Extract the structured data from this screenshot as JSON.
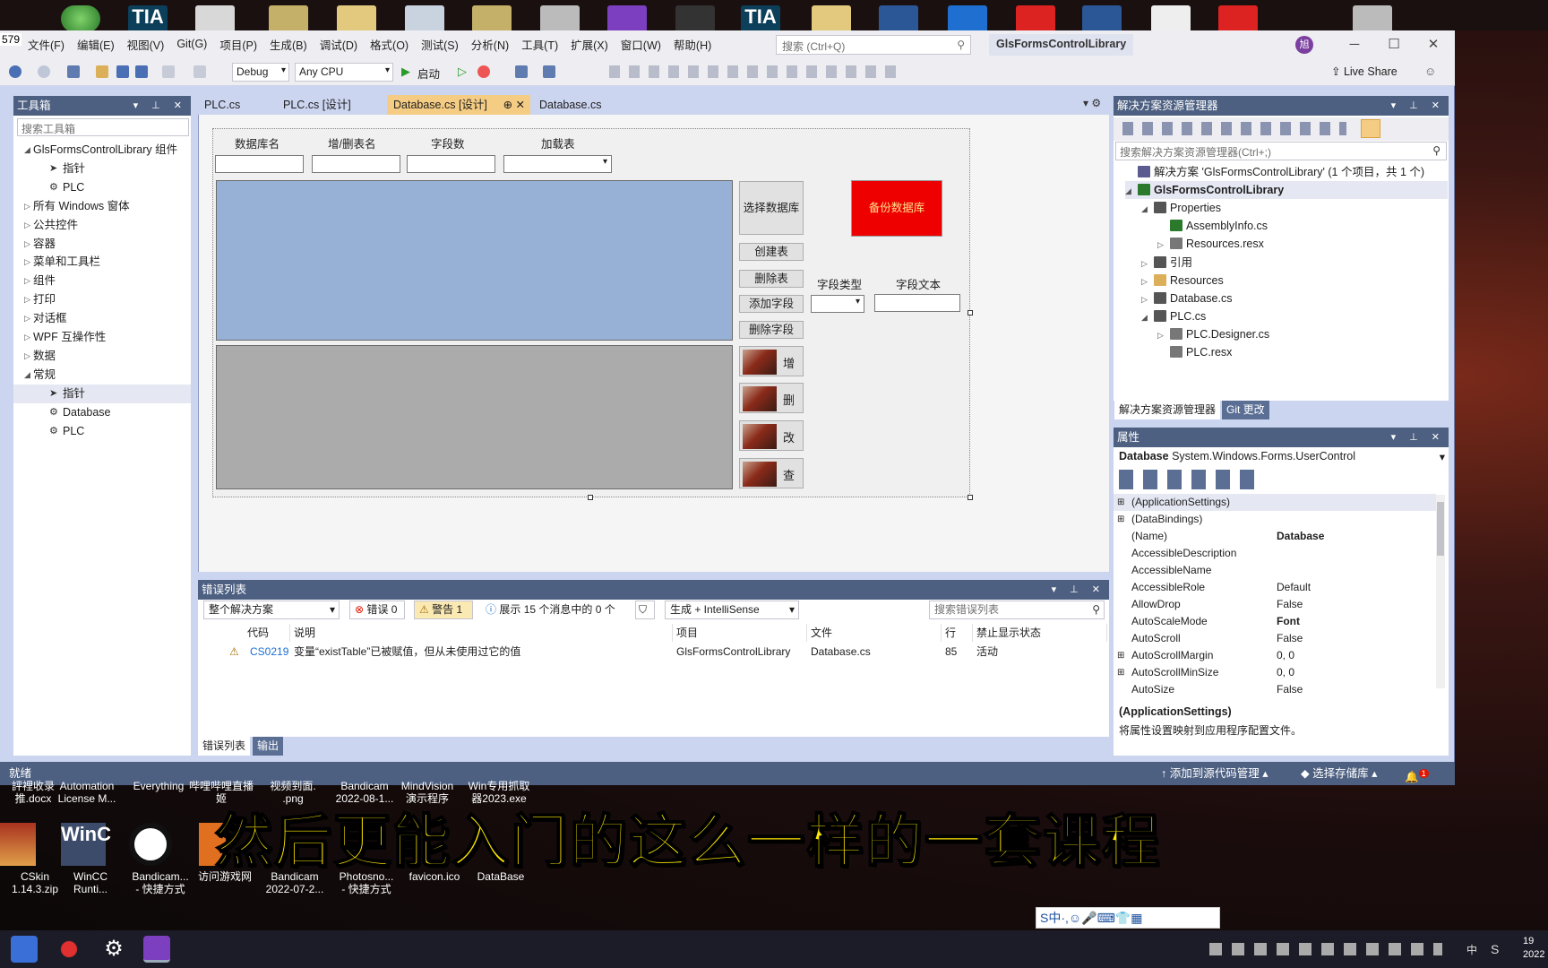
{
  "menu": [
    "文件(F)",
    "编辑(E)",
    "视图(V)",
    "Git(G)",
    "项目(P)",
    "生成(B)",
    "调试(D)",
    "格式(O)",
    "测试(S)",
    "分析(N)",
    "工具(T)",
    "扩展(X)",
    "窗口(W)",
    "帮助(H)"
  ],
  "search_placeholder": "搜索 (Ctrl+Q)",
  "project_title": "GlsFormsControlLibrary",
  "avatar_initial": "旭",
  "toolbar": {
    "config": "Debug",
    "platform": "Any CPU",
    "start": "启动",
    "liveshare": "Live Share"
  },
  "edge_number": "579",
  "toolbox": {
    "title": "工具箱",
    "search": "搜索工具箱",
    "items": [
      {
        "label": "GlsFormsControlLibrary 组件",
        "expand": "◢"
      },
      {
        "label": "指针",
        "expand": ""
      },
      {
        "label": "PLC",
        "expand": ""
      },
      {
        "label": "所有 Windows 窗体",
        "expand": "▷"
      },
      {
        "label": "公共控件",
        "expand": "▷"
      },
      {
        "label": "容器",
        "expand": "▷"
      },
      {
        "label": "菜单和工具栏",
        "expand": "▷"
      },
      {
        "label": "组件",
        "expand": "▷"
      },
      {
        "label": "打印",
        "expand": "▷"
      },
      {
        "label": "对话框",
        "expand": "▷"
      },
      {
        "label": "WPF 互操作性",
        "expand": "▷"
      },
      {
        "label": "数据",
        "expand": "▷"
      },
      {
        "label": "常规",
        "expand": "◢"
      },
      {
        "label": "指针",
        "expand": ""
      },
      {
        "label": "Database",
        "expand": ""
      },
      {
        "label": "PLC",
        "expand": ""
      }
    ]
  },
  "tabs": [
    "PLC.cs",
    "PLC.cs [设计]",
    "Database.cs [设计]",
    "Database.cs"
  ],
  "form": {
    "lbl_db": "数据库名",
    "lbl_table": "增/删表名",
    "lbl_fields": "字段数",
    "lbl_load": "加载表",
    "btn_select": "选择数据库",
    "btn_backup": "备份数据库",
    "btn_create": "创建表",
    "btn_delete": "删除表",
    "btn_addfield": "添加字段",
    "btn_delfield": "删除字段",
    "lbl_fieldtype": "字段类型",
    "lbl_fieldtext": "字段文本",
    "btn_add": "增",
    "btn_del": "删",
    "btn_mod": "改",
    "btn_query": "查"
  },
  "errorlist": {
    "title": "错误列表",
    "scope": "整个解决方案",
    "errors": "错误 0",
    "warnings": "警告 1",
    "messages": "展示 15 个消息中的 0 个",
    "build": "生成 + IntelliSense",
    "search": "搜索错误列表",
    "columns": [
      "代码",
      "说明",
      "项目",
      "文件",
      "行",
      "禁止显示状态"
    ],
    "rows": [
      {
        "code": "CS0219",
        "desc": "变量“existTable”已被赋值，但从未使用过它的值",
        "project": "GlsFormsControlLibrary",
        "file": "Database.cs",
        "line": "85",
        "status": "活动"
      }
    ]
  },
  "bottomtabs": [
    "错误列表",
    "输出"
  ],
  "solution": {
    "title": "解决方案资源管理器",
    "search": "搜索解决方案资源管理器(Ctrl+;)",
    "items": [
      {
        "label": "解决方案 'GlsFormsControlLibrary' (1 个项目，共 1 个)",
        "depth": 0,
        "tri": "",
        "bold": false,
        "icon": "#5b5b8f"
      },
      {
        "label": "GlsFormsControlLibrary",
        "depth": 0,
        "tri": "◢",
        "bold": true,
        "icon": "#2b7a2b"
      },
      {
        "label": "Properties",
        "depth": 1,
        "tri": "◢",
        "bold": false,
        "icon": "#555"
      },
      {
        "label": "AssemblyInfo.cs",
        "depth": 2,
        "tri": "",
        "bold": false,
        "icon": "#2b7a2b"
      },
      {
        "label": "Resources.resx",
        "depth": 2,
        "tri": "▷",
        "bold": false,
        "icon": "#777"
      },
      {
        "label": "引用",
        "depth": 1,
        "tri": "▷",
        "bold": false,
        "icon": "#555"
      },
      {
        "label": "Resources",
        "depth": 1,
        "tri": "▷",
        "bold": false,
        "icon": "#dcb05a"
      },
      {
        "label": "Database.cs",
        "depth": 1,
        "tri": "▷",
        "bold": false,
        "icon": "#555"
      },
      {
        "label": "PLC.cs",
        "depth": 1,
        "tri": "◢",
        "bold": false,
        "icon": "#555"
      },
      {
        "label": "PLC.Designer.cs",
        "depth": 2,
        "tri": "▷",
        "bold": false,
        "icon": "#777"
      },
      {
        "label": "PLC.resx",
        "depth": 2,
        "tri": "",
        "bold": false,
        "icon": "#777"
      }
    ],
    "tabs": [
      "解决方案资源管理器",
      "Git 更改"
    ]
  },
  "properties": {
    "title": "属性",
    "object": "Database",
    "type": "System.Windows.Forms.UserControl",
    "rows": [
      {
        "name": "(ApplicationSettings)",
        "value": "",
        "plus": "⊞",
        "bold": false
      },
      {
        "name": "(DataBindings)",
        "value": "",
        "plus": "⊞",
        "bold": false
      },
      {
        "name": "(Name)",
        "value": "Database",
        "plus": "",
        "bold": true
      },
      {
        "name": "AccessibleDescription",
        "value": "",
        "plus": "",
        "bold": false
      },
      {
        "name": "AccessibleName",
        "value": "",
        "plus": "",
        "bold": false
      },
      {
        "name": "AccessibleRole",
        "value": "Default",
        "plus": "",
        "bold": false
      },
      {
        "name": "AllowDrop",
        "value": "False",
        "plus": "",
        "bold": false
      },
      {
        "name": "AutoScaleMode",
        "value": "Font",
        "plus": "",
        "bold": true
      },
      {
        "name": "AutoScroll",
        "value": "False",
        "plus": "",
        "bold": false
      },
      {
        "name": "AutoScrollMargin",
        "value": "0, 0",
        "plus": "⊞",
        "bold": false
      },
      {
        "name": "AutoScrollMinSize",
        "value": "0, 0",
        "plus": "⊞",
        "bold": false
      },
      {
        "name": "AutoSize",
        "value": "False",
        "plus": "",
        "bold": false
      }
    ],
    "desc_title": "(ApplicationSettings)",
    "desc_text": "将属性设置映射到应用程序配置文件。"
  },
  "status": {
    "ready": "就绪",
    "source": "添加到源代码管理",
    "repo": "选择存储库",
    "notif": "1"
  },
  "desktop": {
    "row1": [
      "評裡收录\n推.docx",
      "Automation\nLicense M...",
      "Everything",
      "哔哩哔哩直播\n姬",
      "视频到面.\n.png",
      "Bandicam\n2022-08-1...",
      "MindVision\n演示程序",
      "Win专用抓取\n器2023.exe"
    ],
    "row2": [
      "CSkin\n1.14.3.zip",
      "WinCC\nRunti...",
      "Bandicam...\n- 快捷方式",
      "访问游戏网",
      "Bandicam\n2022-07-2...",
      "Photosno...\n- 快捷方式",
      "favicon.ico",
      "DataBase"
    ]
  },
  "subtitle": "然后更能入门的这么一样的一套课程",
  "ime": "S中·,☺🎤⌨👕▦",
  "clock": {
    "time": "19",
    "date": "2022"
  },
  "tray_lang": "中"
}
